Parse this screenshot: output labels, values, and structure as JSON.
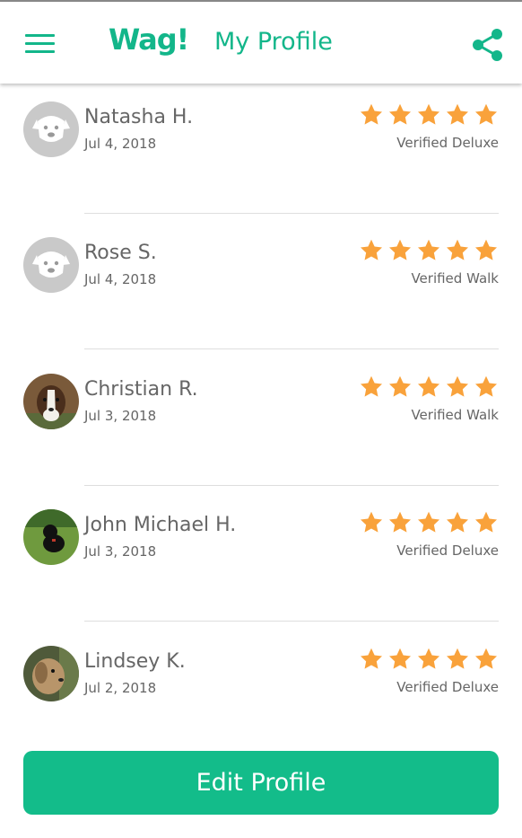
{
  "header": {
    "logo": "Wag!",
    "title": "My Profile",
    "menu_icon": "hamburger-menu-icon",
    "share_icon": "share-icon"
  },
  "colors": {
    "brand": "#13b68a",
    "button": "#13bc8a",
    "star": "#f9a23b"
  },
  "reviews": [
    {
      "name": "Natasha H.",
      "date": "Jul 4, 2018",
      "rating": 5,
      "service": "Verified Deluxe",
      "avatar": "default-dog-avatar"
    },
    {
      "name": "Rose S.",
      "date": "Jul 4, 2018",
      "rating": 5,
      "service": "Verified Walk",
      "avatar": "default-dog-avatar"
    },
    {
      "name": "Christian R.",
      "date": "Jul 3, 2018",
      "rating": 5,
      "service": "Verified Walk",
      "avatar": "dog-photo-avatar"
    },
    {
      "name": "John Michael H.",
      "date": "Jul 3, 2018",
      "rating": 5,
      "service": "Verified Deluxe",
      "avatar": "dog-photo-avatar"
    },
    {
      "name": "Lindsey K.",
      "date": "Jul 2, 2018",
      "rating": 5,
      "service": "Verified Deluxe",
      "avatar": "dog-photo-avatar"
    }
  ],
  "footer": {
    "edit_label": "Edit Profile"
  }
}
